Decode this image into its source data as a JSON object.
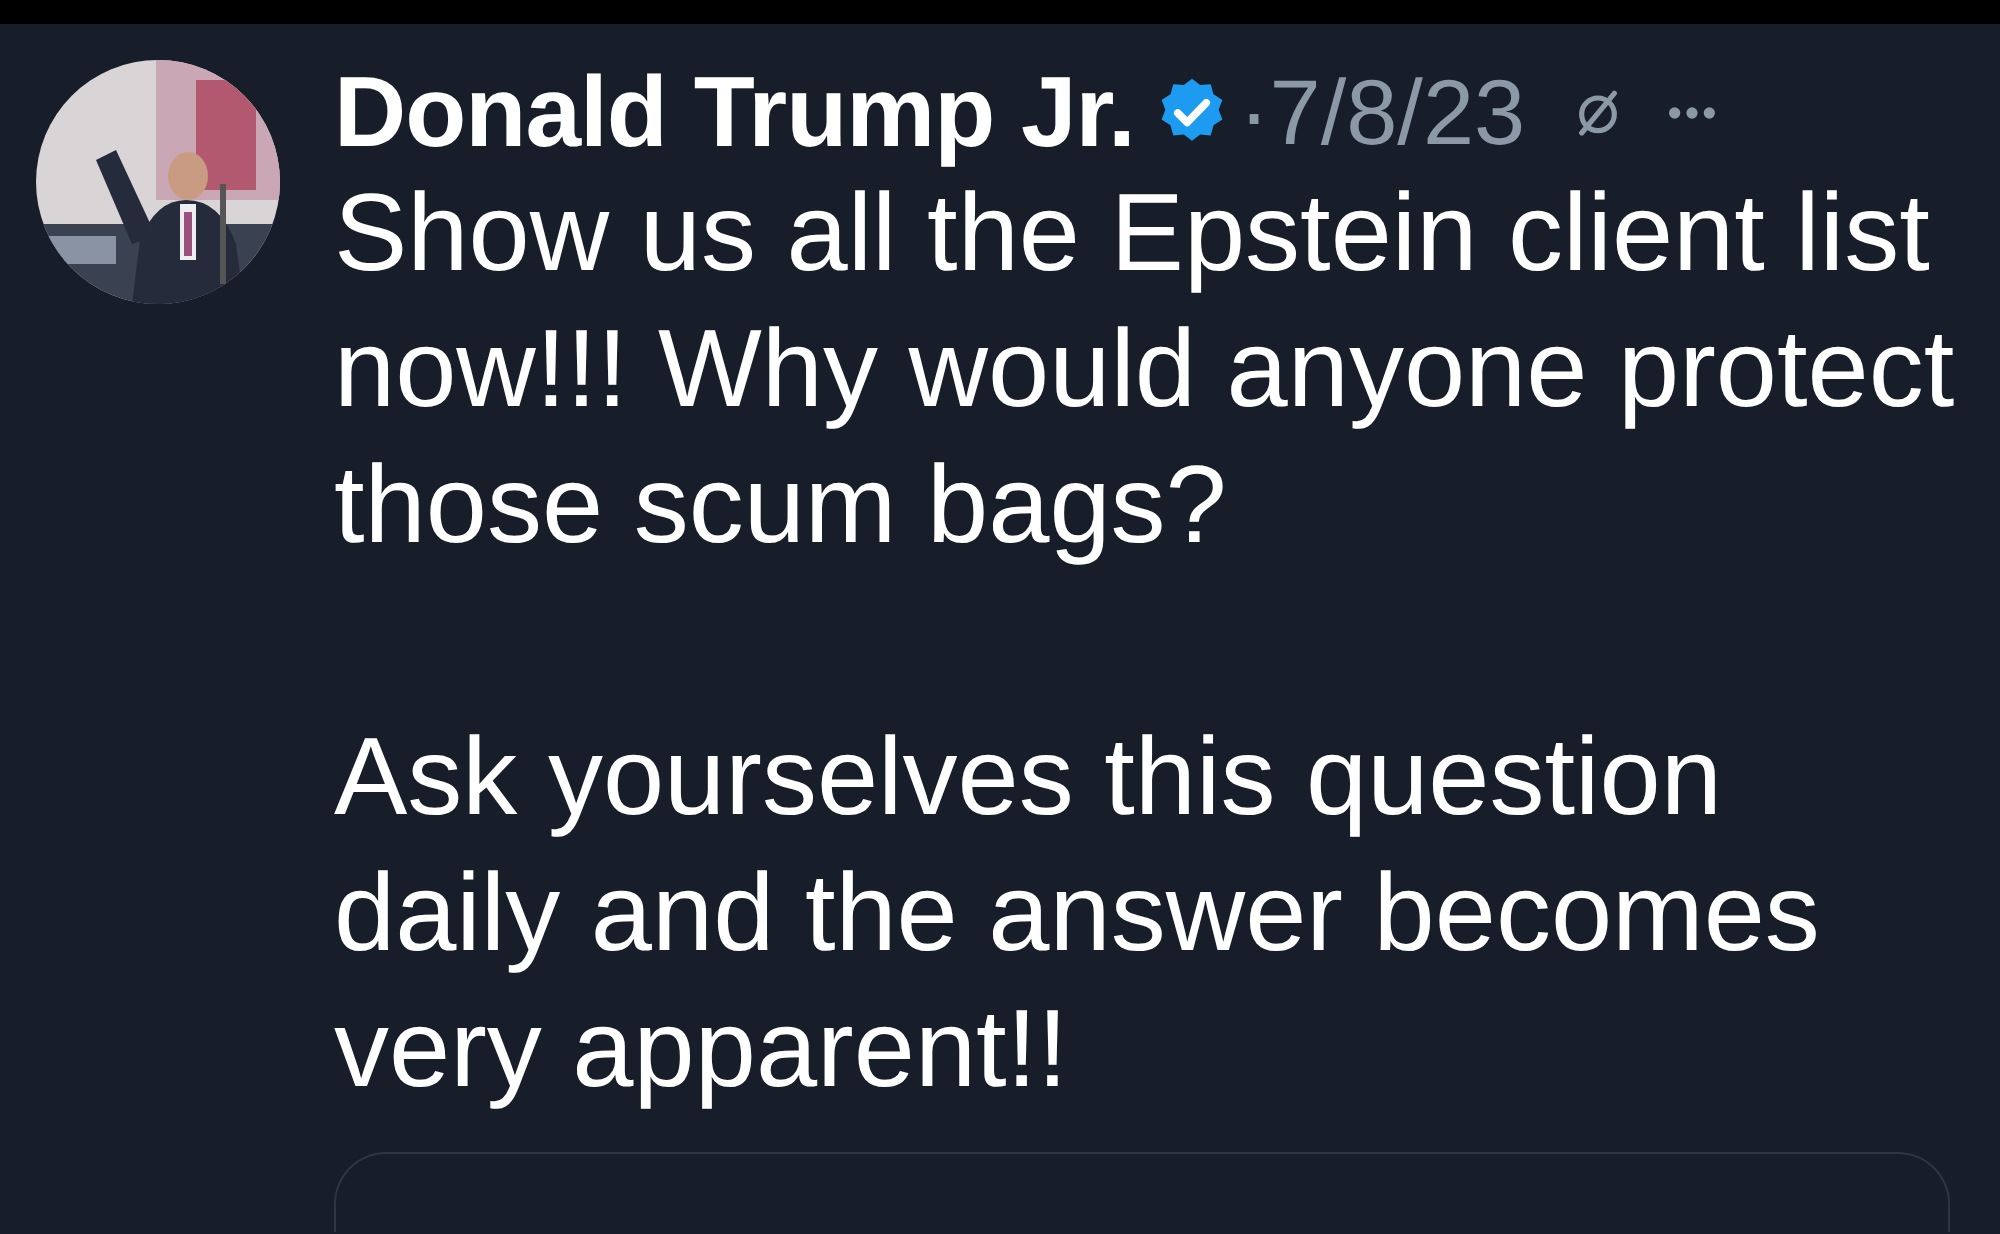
{
  "post": {
    "author": "Donald Trump Jr.",
    "verified": true,
    "separator": "·",
    "date": "7/8/23",
    "paragraphs": [
      "Show us all the Epstein client list now!!! Why would anyone protect those scum bags?",
      "Ask yourselves this question daily and the answer becomes very apparent!!"
    ]
  }
}
